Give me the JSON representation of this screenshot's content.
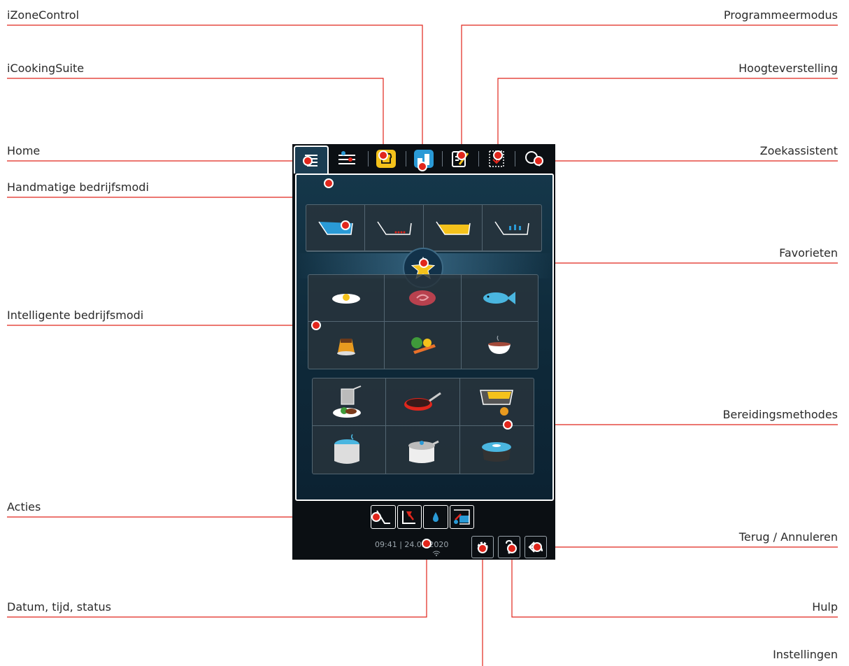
{
  "callouts": {
    "izonecontrol": "iZoneControl",
    "icookingsuite": "iCookingSuite",
    "home": "Home",
    "handmatige": "Handmatige bedrijfsmodi",
    "intelligente": "Intelligente bedrijfsmodi",
    "acties": "Acties",
    "datum": "Datum, tijd, status",
    "programmeermodus": "Programmeermodus",
    "hoogteverstelling": "Hoogteverstelling",
    "zoekassistent": "Zoekassistent",
    "favorieten": "Favorieten",
    "bereidingsmethodes": "Bereidingsmethodes",
    "terug": "Terug / Annuleren",
    "hulp": "Hulp",
    "instellingen": "Instellingen"
  },
  "device": {
    "time": "09:41",
    "date": "24.03.2020",
    "tabs": [
      "home-icon",
      "manual-modes-icon",
      "icookingsuite-icon",
      "izonecontrol-icon",
      "programming-mode-icon",
      "height-adjust-icon",
      "search-icon"
    ],
    "manual_modes": [
      "steam-mode",
      "convection-mode",
      "combination-mode",
      "finishing-mode"
    ],
    "intelligent_modes": [
      "poultry",
      "meat",
      "fish",
      "egg-dishes",
      "side-dishes",
      "soups"
    ],
    "cooking_methods": [
      "deep-frying",
      "pan-frying",
      "shallow-frying",
      "boiling",
      "cooking",
      "stewing"
    ],
    "actions": [
      "action-1",
      "action-2",
      "action-3",
      "action-4"
    ]
  },
  "colors": {
    "accent": "#e1261c",
    "yellow": "#f4c21b",
    "blue": "#2a9ad6",
    "screen": "#0b0f13"
  }
}
